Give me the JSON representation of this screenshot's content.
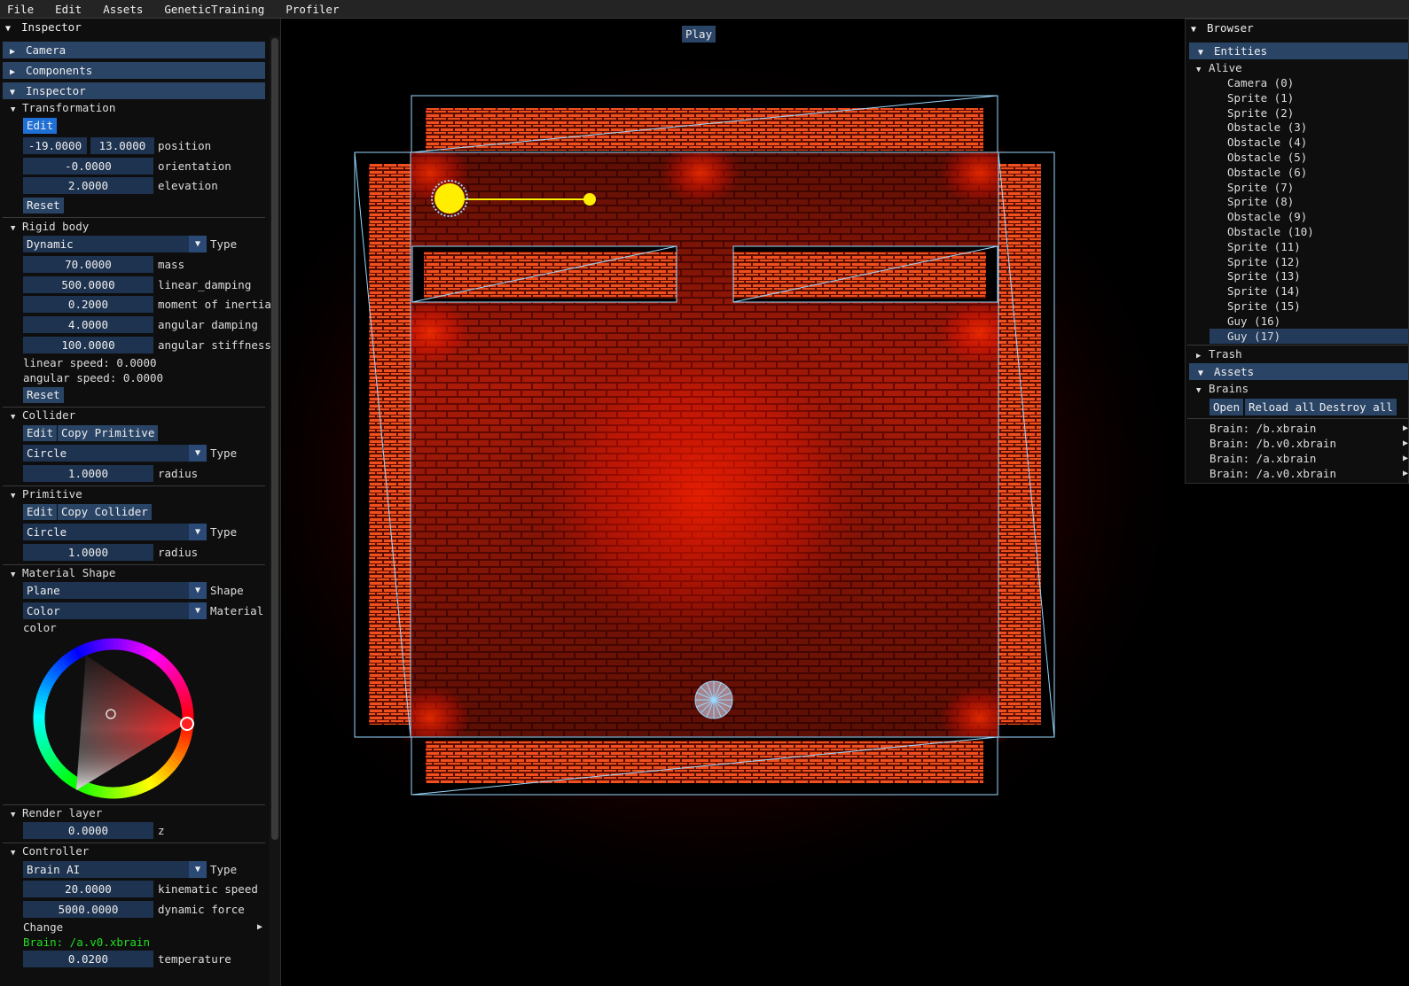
{
  "menu": [
    "File",
    "Edit",
    "Assets",
    "GeneticTraining",
    "Profiler"
  ],
  "inspector_window": {
    "title": "Inspector",
    "headers": {
      "camera": "Camera",
      "components": "Components",
      "inspector": "Inspector"
    },
    "transformation": {
      "title": "Transformation",
      "edit": "Edit",
      "pos_x": "-19.0000",
      "pos_y": "13.0000",
      "position_label": "position",
      "orientation": "-0.0000",
      "orientation_label": "orientation",
      "elevation": "2.0000",
      "elevation_label": "elevation",
      "reset": "Reset"
    },
    "rigid_body": {
      "title": "Rigid body",
      "type": "Dynamic",
      "type_label": "Type",
      "mass": "70.0000",
      "mass_label": "mass",
      "linear_damping": "500.0000",
      "linear_damping_label": "linear_damping",
      "moment": "0.2000",
      "moment_label": "moment of inertia",
      "angular_damping": "4.0000",
      "angular_damping_label": "angular damping",
      "angular_stiffness": "100.0000",
      "angular_stiffness_label": "angular stiffness",
      "linear_speed": "linear speed: 0.0000",
      "angular_speed": "angular speed: 0.0000",
      "reset": "Reset"
    },
    "collider": {
      "title": "Collider",
      "edit": "Edit",
      "copy": "Copy Primitive",
      "type": "Circle",
      "type_label": "Type",
      "radius": "1.0000",
      "radius_label": "radius"
    },
    "primitive": {
      "title": "Primitive",
      "edit": "Edit",
      "copy": "Copy Collider",
      "type": "Circle",
      "type_label": "Type",
      "radius": "1.0000",
      "radius_label": "radius"
    },
    "material_shape": {
      "title": "Material Shape",
      "shape": "Plane",
      "shape_label": "Shape",
      "material": "Color",
      "material_label": "Material",
      "color_label": "color",
      "selected_color": "#ff2222"
    },
    "render_layer": {
      "title": "Render layer",
      "z": "0.0000",
      "z_label": "z"
    },
    "controller": {
      "title": "Controller",
      "type": "Brain AI",
      "type_label": "Type",
      "kinematic_speed": "20.0000",
      "kinematic_speed_label": "kinematic speed",
      "dynamic_force": "5000.0000",
      "dynamic_force_label": "dynamic force",
      "change": "Change",
      "brain": "Brain: /a.v0.xbrain",
      "temperature": "0.0200",
      "temperature_label": "temperature"
    }
  },
  "viewport": {
    "play": "Play",
    "wall_color": "#e8421c",
    "accent": "#ffee00"
  },
  "browser": {
    "title": "Browser",
    "entities_header": "Entities",
    "alive_label": "Alive",
    "entities": [
      "Camera (0)",
      "Sprite (1)",
      "Sprite (2)",
      "Obstacle (3)",
      "Obstacle (4)",
      "Obstacle (5)",
      "Obstacle (6)",
      "Sprite (7)",
      "Sprite (8)",
      "Obstacle (9)",
      "Obstacle (10)",
      "Sprite (11)",
      "Sprite (12)",
      "Sprite (13)",
      "Sprite (14)",
      "Sprite (15)",
      "Guy (16)",
      "Guy (17)"
    ],
    "selected_entity": "Guy (17)",
    "trash_label": "Trash",
    "assets_header": "Assets",
    "brains_label": "Brains",
    "open": "Open",
    "reload_all": "Reload all",
    "destroy_all": "Destroy all",
    "assets": [
      "Brain: /b.xbrain",
      "Brain: /b.v0.xbrain",
      "Brain: /a.xbrain",
      "Brain: /a.v0.xbrain"
    ]
  }
}
